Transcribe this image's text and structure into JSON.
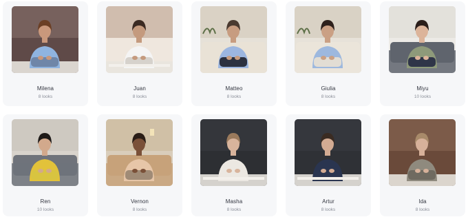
{
  "avatars": [
    {
      "name": "Milena",
      "looks": "8 looks",
      "bg": "#5f4a48",
      "wall": "#8a7570",
      "skin": "#c9987c",
      "hair": "#6b3f25",
      "shirt": "#8fb4e0",
      "pants": "#6f86a8",
      "sofa": null
    },
    {
      "name": "Juan",
      "looks": "8 looks",
      "bg": "#efe7de",
      "wall": "#b79a86",
      "skin": "#c49a7e",
      "hair": "#3b2a22",
      "shirt": "#f4f4f4",
      "pants": "#d6d2cc",
      "sofa": null
    },
    {
      "name": "Matteo",
      "looks": "8 looks",
      "bg": "#e6e1d8",
      "wall": "#cfc6b6",
      "skin": "#c79c80",
      "hair": "#4a3a30",
      "shirt": "#9cb6e0",
      "pants": "#2c3140",
      "sofa": "#e9e2d6"
    },
    {
      "name": "Giulia",
      "looks": "8 looks",
      "bg": "#e7e2d9",
      "wall": "#cdc4b5",
      "skin": "#caa084",
      "hair": "#2e211c",
      "shirt": "#9db8de",
      "pants": "#e2ddd4",
      "sofa": "#ebe5da"
    },
    {
      "name": "Miyu",
      "looks": "10 looks",
      "bg": "#eceae6",
      "wall": "#dcd8d2",
      "skin": "#dcb49a",
      "hair": "#2a1e1a",
      "shirt": "#8e9a7a",
      "pants": "#2f3548",
      "sofa": "#5f646d"
    },
    {
      "name": "Ren",
      "looks": "10 looks",
      "bg": "#d8d3cc",
      "wall": "#c7c1b8",
      "skin": "#d2a98c",
      "hair": "#1e1a18",
      "shirt": "#e2c23a",
      "pants": "#d8c440",
      "sofa": "#6f737b"
    },
    {
      "name": "Vernon",
      "looks": "8 looks",
      "bg": "#d9cdbb",
      "wall": "#c9b796",
      "skin": "#7a5038",
      "hair": "#2a1d16",
      "shirt": "#e7c6a8",
      "pants": "#a08b76",
      "sofa": "#c7a27a"
    },
    {
      "name": "Masha",
      "looks": "8 looks",
      "bg": "#2d2f33",
      "wall": "#3b3d42",
      "skin": "#d8b49c",
      "hair": "#9a7a5c",
      "shirt": "#ece8e2",
      "pants": "#ece8e2",
      "sofa": null
    },
    {
      "name": "Artur",
      "looks": "8 looks",
      "bg": "#2f3136",
      "wall": "#3a3d44",
      "skin": "#d3ab93",
      "hair": "#3a2b22",
      "shirt": "#2a3550",
      "pants": "#2a3550",
      "sofa": null
    },
    {
      "name": "Ida",
      "looks": "8 looks",
      "bg": "#6a4a3a",
      "wall": "#8a6a55",
      "skin": "#d7b19a",
      "hair": "#a88a6a",
      "shirt": "#8f8a7e",
      "pants": "#6f6a60",
      "sofa": null
    }
  ]
}
